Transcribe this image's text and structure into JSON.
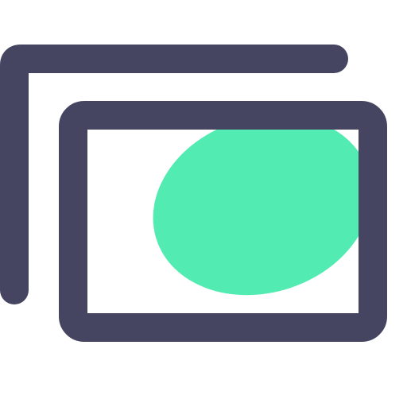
{
  "icon": {
    "name": "gallery-icon",
    "colors": {
      "stroke": "#454562",
      "accent": "#52EBB1",
      "background": "#FFFFFF"
    }
  }
}
